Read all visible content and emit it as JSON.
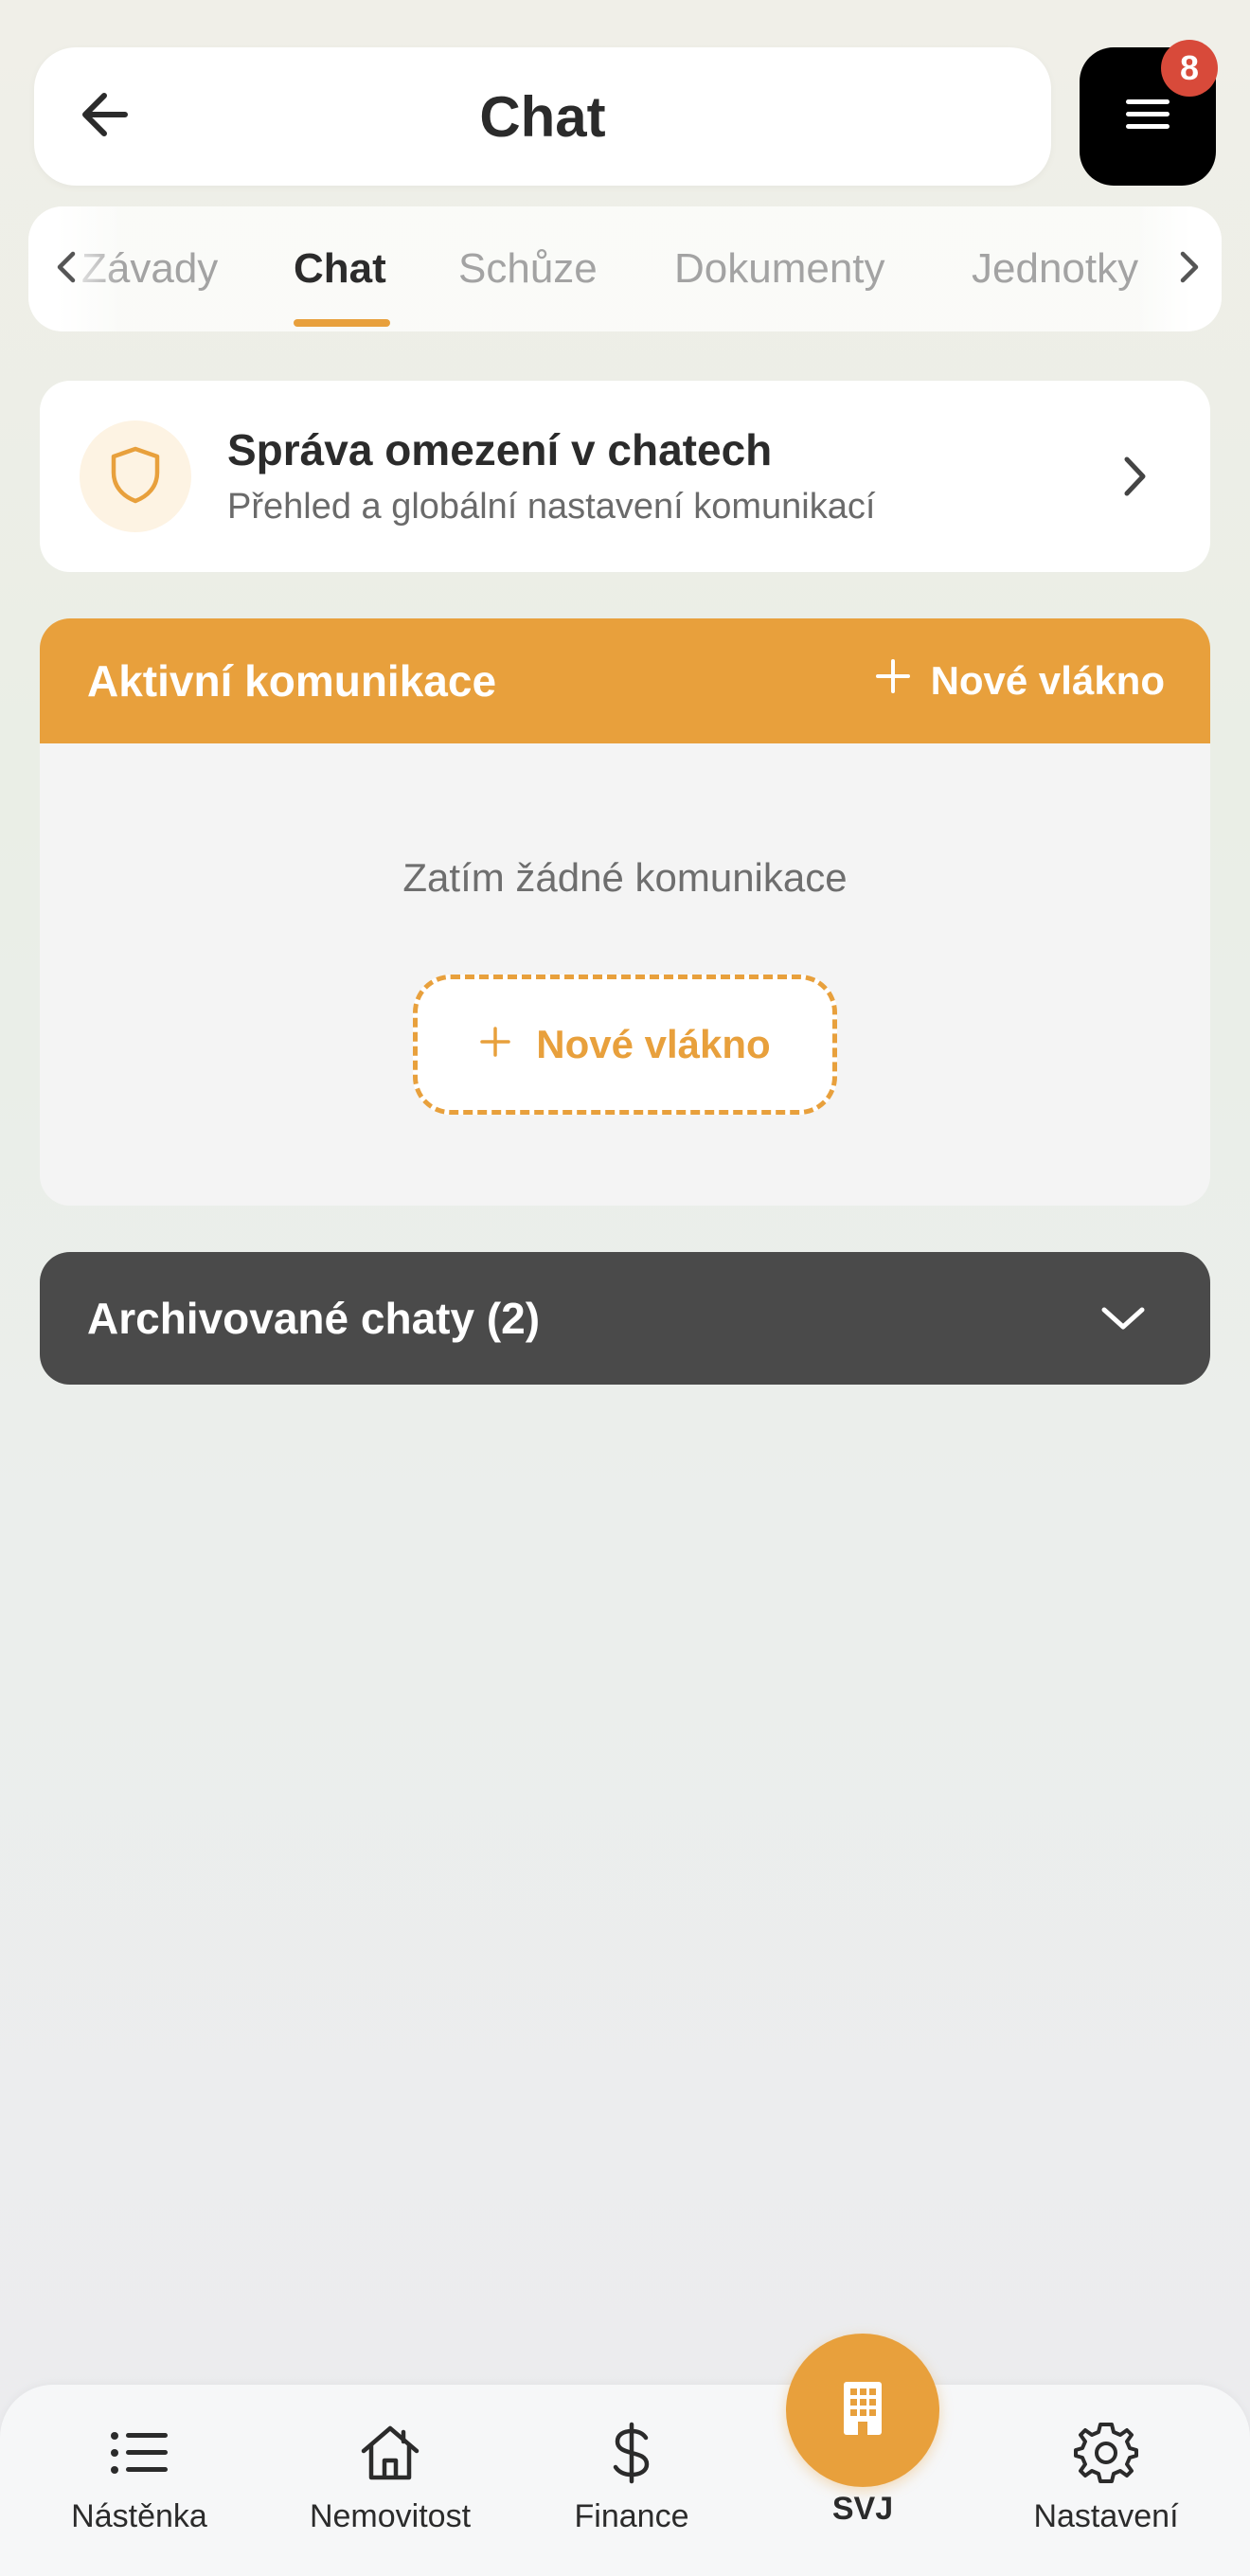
{
  "header": {
    "title": "Chat",
    "menu_badge_count": "8",
    "icons": {
      "back": "arrow-left-icon",
      "menu": "hamburger-menu-icon"
    }
  },
  "tabs": {
    "items": [
      {
        "label": "Závady",
        "active": false
      },
      {
        "label": "Chat",
        "active": true
      },
      {
        "label": "Schůze",
        "active": false
      },
      {
        "label": "Dokumenty",
        "active": false
      },
      {
        "label": "Jednotky",
        "active": false
      }
    ],
    "icons": {
      "left": "chevron-left-icon",
      "right": "chevron-right-icon"
    }
  },
  "restrictions_card": {
    "title": "Správa omezení v chatech",
    "subtitle": "Přehled a globální nastavení komunikací",
    "icon": "shield-icon"
  },
  "active_section": {
    "title": "Aktivní komunikace",
    "new_thread_label": "Nové vlákno",
    "empty_text": "Zatím žádné komunikace",
    "empty_new_thread_label": "Nové vlákno"
  },
  "archived": {
    "label": "Archivované chaty (2)",
    "icon": "chevron-down-icon"
  },
  "bottom_nav": {
    "items": [
      {
        "label": "Nástěnka",
        "icon": "list-icon"
      },
      {
        "label": "Nemovitost",
        "icon": "house-icon"
      },
      {
        "label": "Finance",
        "icon": "dollar-icon"
      },
      {
        "label": "SVJ",
        "icon": "building-icon",
        "active": true
      },
      {
        "label": "Nastavení",
        "icon": "gear-icon"
      }
    ]
  },
  "colors": {
    "accent": "#e8a03c",
    "dark": "#4a4a4a",
    "badge": "#d84a3a",
    "text": "#2b2b2b"
  }
}
